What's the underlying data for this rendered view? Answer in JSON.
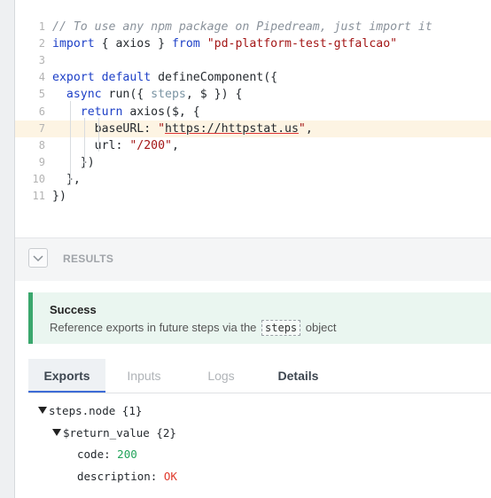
{
  "editor": {
    "lines": [
      {
        "n": "1",
        "tokens": [
          {
            "t": "comment",
            "v": "// To use any npm package on Pipedream, just import it"
          }
        ]
      },
      {
        "n": "2",
        "tokens": [
          {
            "t": "kw",
            "v": "import"
          },
          {
            "t": "plain",
            "v": " { axios } "
          },
          {
            "t": "kw",
            "v": "from"
          },
          {
            "t": "plain",
            "v": " "
          },
          {
            "t": "str",
            "v": "\"pd-platform-test-gtfalcao\""
          }
        ]
      },
      {
        "n": "3",
        "tokens": []
      },
      {
        "n": "4",
        "tokens": [
          {
            "t": "kw",
            "v": "export"
          },
          {
            "t": "plain",
            "v": " "
          },
          {
            "t": "kw",
            "v": "default"
          },
          {
            "t": "plain",
            "v": " defineComponent({"
          }
        ]
      },
      {
        "n": "5",
        "tokens": [
          {
            "t": "plain",
            "v": "  "
          },
          {
            "t": "kw",
            "v": "async"
          },
          {
            "t": "plain",
            "v": " run({ "
          },
          {
            "t": "param",
            "v": "steps"
          },
          {
            "t": "plain",
            "v": ", $ }) {"
          }
        ]
      },
      {
        "n": "6",
        "tokens": [
          {
            "t": "plain",
            "v": "    "
          },
          {
            "t": "kw",
            "v": "return"
          },
          {
            "t": "plain",
            "v": " axios($, {"
          }
        ]
      },
      {
        "n": "7",
        "tokens": [
          {
            "t": "plain",
            "v": "      baseURL: "
          },
          {
            "t": "str",
            "v": "\""
          },
          {
            "t": "url",
            "v": "https://httpstat.us"
          },
          {
            "t": "str",
            "v": "\""
          },
          {
            "t": "plain",
            "v": ","
          }
        ]
      },
      {
        "n": "8",
        "tokens": [
          {
            "t": "plain",
            "v": "      url: "
          },
          {
            "t": "str",
            "v": "\"/200\""
          },
          {
            "t": "plain",
            "v": ","
          }
        ]
      },
      {
        "n": "9",
        "tokens": [
          {
            "t": "plain",
            "v": "    })"
          }
        ]
      },
      {
        "n": "10",
        "tokens": [
          {
            "t": "plain",
            "v": "  },"
          }
        ]
      },
      {
        "n": "11",
        "tokens": [
          {
            "t": "plain",
            "v": "})"
          }
        ]
      }
    ],
    "highlighted_line": "7"
  },
  "results": {
    "label": "RESULTS",
    "collapse_icon": "chevron-down-icon"
  },
  "success": {
    "title": "Success",
    "desc_before": "Reference exports in future steps via the",
    "chip": "steps",
    "desc_after": "object",
    "accent": "#3aa76d"
  },
  "tabs": [
    {
      "label": "Exports",
      "active": true
    },
    {
      "label": "Inputs",
      "active": false
    },
    {
      "label": "Logs",
      "active": false
    },
    {
      "label": "Details",
      "active": false
    }
  ],
  "tree": {
    "root_key": "steps.node",
    "root_count": "{1}",
    "child_key": "$return_value",
    "child_count": "{2}",
    "fields": [
      {
        "key": "code:",
        "value": "200",
        "kind": "num"
      },
      {
        "key": "description:",
        "value": "OK",
        "kind": "str"
      }
    ]
  }
}
